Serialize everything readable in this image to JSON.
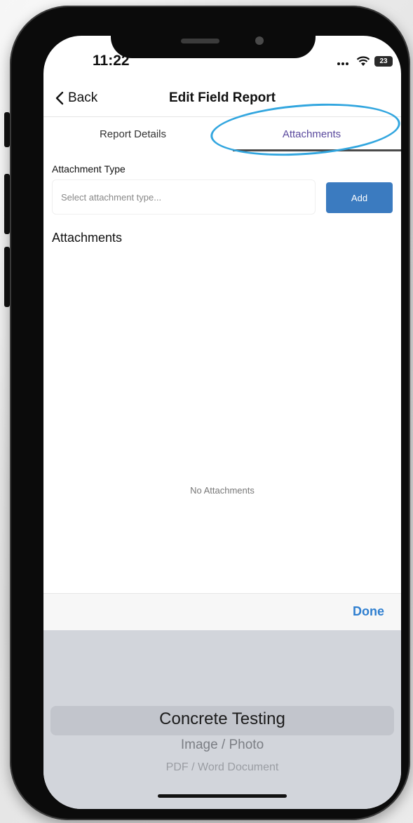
{
  "status_bar": {
    "time": "11:22",
    "battery": "23"
  },
  "nav": {
    "back_label": "Back",
    "title": "Edit Field Report"
  },
  "tabs": [
    {
      "label": "Report Details",
      "active": false
    },
    {
      "label": "Attachments",
      "active": true
    }
  ],
  "form": {
    "attachment_type_label": "Attachment Type",
    "attachment_type_placeholder": "Select attachment type...",
    "add_label": "Add"
  },
  "attachments": {
    "heading": "Attachments",
    "empty_text": "No Attachments"
  },
  "toolbar": {
    "done_label": "Done"
  },
  "picker": {
    "selected": "Concrete Testing",
    "options": [
      "Image / Photo",
      "PDF / Word Document"
    ]
  },
  "colors": {
    "accent": "#3b7bc0",
    "active_tab": "#5b4a9e",
    "done": "#2f7fd0",
    "highlight_oval": "#32a6df"
  }
}
